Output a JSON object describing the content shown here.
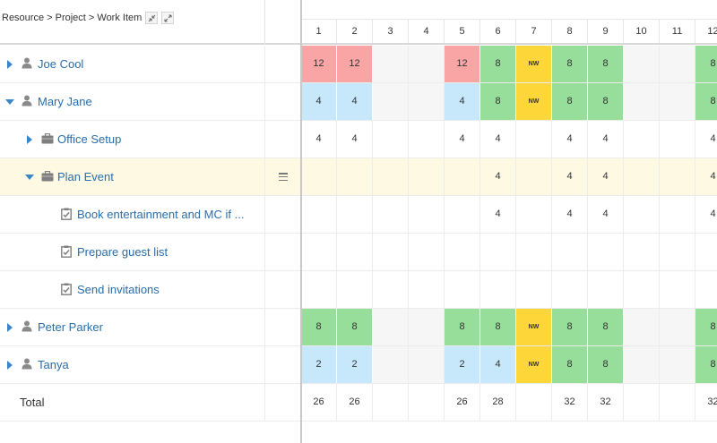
{
  "header": {
    "breadcrumb": "Resource > Project > Work Item",
    "collapse_icon": "collapse-icon",
    "expand_icon": "expand-icon"
  },
  "days": [
    "1",
    "2",
    "3",
    "4",
    "5",
    "6",
    "7",
    "8",
    "9",
    "10",
    "11",
    "12"
  ],
  "rows": [
    {
      "label": "Joe Cool",
      "icon": "person-icon",
      "caret": "right"
    },
    {
      "label": "Mary Jane",
      "icon": "person-icon",
      "caret": "down"
    },
    {
      "label": "Office Setup",
      "icon": "briefcase-icon",
      "caret": "right"
    },
    {
      "label": "Plan Event",
      "icon": "briefcase-icon",
      "caret": "down"
    },
    {
      "label": "Book entertainment and MC if ...",
      "icon": "clipboard-check-icon"
    },
    {
      "label": "Prepare guest list",
      "icon": "clipboard-check-icon"
    },
    {
      "label": "Send invitations",
      "icon": "clipboard-check-icon"
    },
    {
      "label": "Peter Parker",
      "icon": "person-icon",
      "caret": "right"
    },
    {
      "label": "Tanya",
      "icon": "person-icon",
      "caret": "right"
    },
    {
      "label": "Total"
    }
  ],
  "grid": [
    [
      "12",
      "12",
      "",
      "",
      "12",
      "8",
      "NW",
      "8",
      "8",
      "",
      "",
      "8"
    ],
    [
      "4",
      "4",
      "",
      "",
      "4",
      "8",
      "NW",
      "8",
      "8",
      "",
      "",
      "8"
    ],
    [
      "4",
      "4",
      "",
      "",
      "4",
      "4",
      "",
      "4",
      "4",
      "",
      "",
      "4"
    ],
    [
      "",
      "",
      "",
      "",
      "",
      "4",
      "",
      "4",
      "4",
      "",
      "",
      "4"
    ],
    [
      "",
      "",
      "",
      "",
      "",
      "4",
      "",
      "4",
      "4",
      "",
      "",
      "4"
    ],
    [
      "",
      "",
      "",
      "",
      "",
      "",
      "",
      "",
      "",
      "",
      "",
      ""
    ],
    [
      "",
      "",
      "",
      "",
      "",
      "",
      "",
      "",
      "",
      "",
      "",
      ""
    ],
    [
      "8",
      "8",
      "",
      "",
      "8",
      "8",
      "NW",
      "8",
      "8",
      "",
      "",
      "8"
    ],
    [
      "2",
      "2",
      "",
      "",
      "2",
      "4",
      "NW",
      "8",
      "8",
      "",
      "",
      "8"
    ],
    [
      "26",
      "26",
      "",
      "",
      "26",
      "28",
      "",
      "32",
      "32",
      "",
      "",
      "32"
    ]
  ],
  "grid_colors": [
    [
      "red",
      "red",
      "gray",
      "gray",
      "red",
      "green",
      "yellow",
      "green",
      "green",
      "gray",
      "gray",
      "green"
    ],
    [
      "blue",
      "blue",
      "gray",
      "gray",
      "blue",
      "green",
      "yellow",
      "green",
      "green",
      "gray",
      "gray",
      "green"
    ],
    [
      "",
      "",
      "",
      "",
      "",
      "",
      "",
      "",
      "",
      "",
      "",
      ""
    ],
    [
      "",
      "",
      "",
      "",
      "",
      "",
      "",
      "",
      "",
      "",
      "",
      ""
    ],
    [
      "",
      "",
      "",
      "",
      "",
      "",
      "",
      "",
      "",
      "",
      "",
      ""
    ],
    [
      "",
      "",
      "",
      "",
      "",
      "",
      "",
      "",
      "",
      "",
      "",
      ""
    ],
    [
      "",
      "",
      "",
      "",
      "",
      "",
      "",
      "",
      "",
      "",
      "",
      ""
    ],
    [
      "green",
      "green",
      "gray",
      "gray",
      "green",
      "green",
      "yellow",
      "green",
      "green",
      "gray",
      "gray",
      "green"
    ],
    [
      "blue",
      "blue",
      "gray",
      "gray",
      "blue",
      "blue",
      "yellow",
      "green",
      "green",
      "gray",
      "gray",
      "green"
    ],
    [
      "",
      "",
      "",
      "",
      "",
      "",
      "",
      "",
      "",
      "",
      "",
      ""
    ]
  ],
  "colors": {
    "over": "#f9a5a5",
    "full": "#96de9a",
    "under": "#c7e8fb",
    "non_working": "#fdd639",
    "link": "#2a6dab",
    "selected_row": "#fef9e3"
  }
}
